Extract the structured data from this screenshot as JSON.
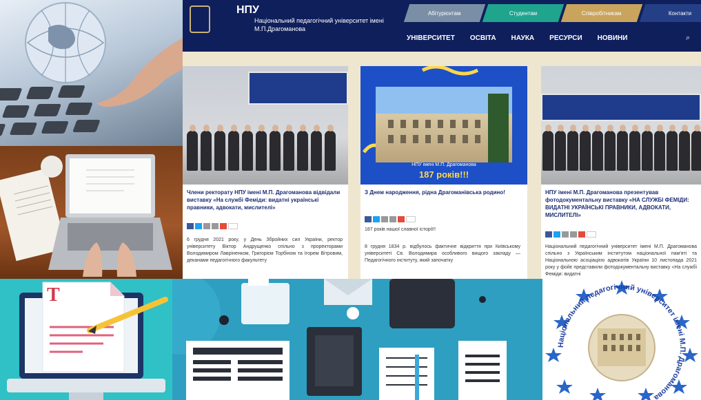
{
  "site": {
    "university_name": "Національний педагогічний університет імені М.П.Драгоманова",
    "logo_letters": "НПУ",
    "top_tabs": [
      {
        "label": "Абітурієнтам",
        "color": "#7a8fa6"
      },
      {
        "label": "Студентам",
        "color": "#1fa48e"
      },
      {
        "label": "Співробітникам",
        "color": "#c9a45c"
      },
      {
        "label": "Контакти",
        "color": "#243f86"
      }
    ],
    "nav": [
      "УНІВЕРСИТЕТ",
      "ОСВІТА",
      "НАУКА",
      "РЕСУРСИ",
      "НОВИНИ"
    ],
    "search_label": "ПОШУК",
    "cards": [
      {
        "title": "Члени ректорату НПУ імені М.П. Драгоманова відвідали виставку «На службі Феміди: видатні українські правники, адвокати, мислителі»",
        "text": "6 грудня 2021 року, у День Збройних сил України, ректор університету Віктор Андрущенко спільно з проректорами Володимиром Лавріненком, Григорієм Торбіном та Ігорем Вітровим, деканами педагогічного факультету"
      },
      {
        "title": "З Днем народження, рідна Драгоманівська родино!",
        "subtitle": "187 років нашої славної історії!!",
        "banner_caption": "НПУ імені М.П. Драгоманова",
        "banner_years": "187 років!!!",
        "text": "8 грудня 1834 р. відбулось фактичне відкриття при Київському університеті Св. Володимира особливого вищого закладу — Педагогічного інституту, який започатку"
      },
      {
        "title": "НПУ імені М.П. Драгоманова презентував фотодокументальну виставку «НА СЛУЖБІ ФЕМІДИ: ВИДАТНІ УКРАЇНСЬКІ ПРАВНИКИ, АДВОКАТИ, МИСЛИТЕЛІ»",
        "text": "Національний педагогічний університет імені М.П. Драгоманова спільно з Українським інститутом національної пам'яті та Національною асоціацією адвокатів України 10 листопада 2021 року у фойє представили фотодокументальну виставку «На службі Феміди: видатні"
      }
    ]
  },
  "doc_illustration": {
    "letter": "T"
  },
  "seal": {
    "text": "Національний педагогічний університет імені М.П. Драгоманова"
  },
  "colors": {
    "site_header": "#0f1f5c",
    "link_blue": "#1e2e73",
    "doc_bg": "#2fc1c6",
    "office_bg": "#2e9fc0",
    "seal_star": "#2a66c9"
  }
}
